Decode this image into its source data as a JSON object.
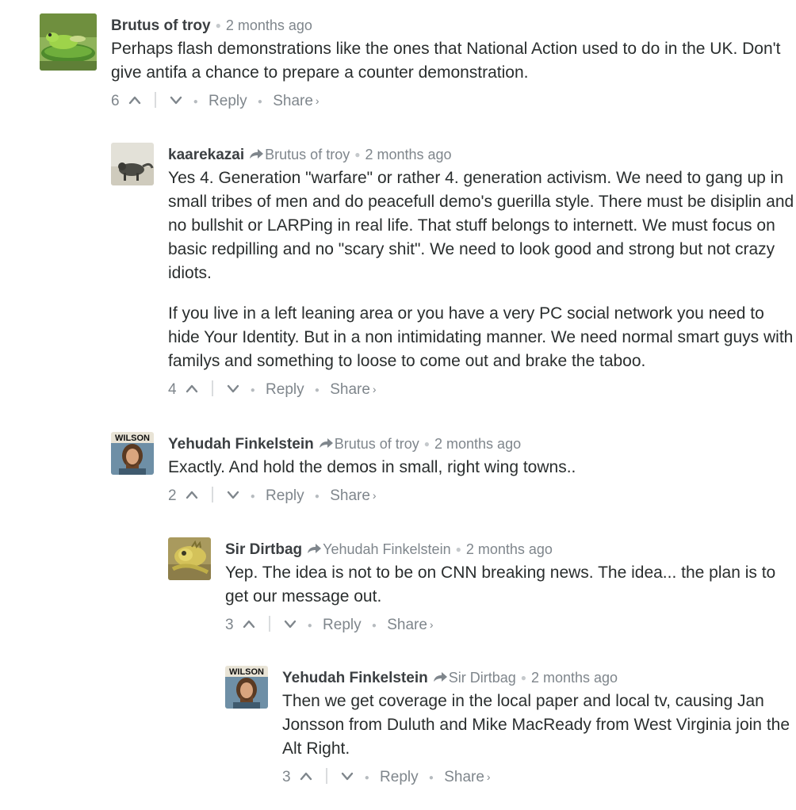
{
  "comments": [
    {
      "author": "Brutus of troy",
      "reply_to": "",
      "time": "2 months ago",
      "paragraphs": [
        "Perhaps flash demonstrations like the ones that National Action used to do in the UK. Don't give antifa a chance to prepare a counter demonstration."
      ],
      "votes": "6",
      "reply_label": "Reply",
      "share_label": "Share",
      "avatar_icon": "frog-on-lilypad-avatar"
    },
    {
      "author": "kaarekazai",
      "reply_to": "Brutus of troy",
      "time": "2 months ago",
      "paragraphs": [
        "Yes 4. Generation \"warfare\" or rather 4. generation activism. We need to gang up in small tribes of men and do peacefull demo's guerilla style. There must be disiplin and no bullshit or LARPing in real life. That stuff belongs to internett. We must focus on basic redpilling and no \"scary shit\". We need to look good and strong but not crazy idiots.",
        "If you live in a left leaning area or you have a very PC social network you need to hide Your Identity. But in a non intimidating manner. We need normal smart guys with familys and something to loose to come out and brake the taboo."
      ],
      "votes": "4",
      "reply_label": "Reply",
      "share_label": "Share",
      "avatar_icon": "animal-photo-avatar"
    },
    {
      "author": "Yehudah Finkelstein",
      "reply_to": "Brutus of troy",
      "time": "2 months ago",
      "paragraphs": [
        "Exactly. And hold the demos in small, right wing towns.."
      ],
      "votes": "2",
      "reply_label": "Reply",
      "share_label": "Share",
      "avatar_icon": "wilson-poster-avatar",
      "avatar_text": "WILSON"
    },
    {
      "author": "Sir Dirtbag",
      "reply_to": "Yehudah Finkelstein",
      "time": "2 months ago",
      "paragraphs": [
        "Yep. The idea is not to be on CNN breaking news. The idea... the plan is to get our message out."
      ],
      "votes": "3",
      "reply_label": "Reply",
      "share_label": "Share",
      "avatar_icon": "iguana-avatar"
    },
    {
      "author": "Yehudah Finkelstein",
      "reply_to": "Sir Dirtbag",
      "time": "2 months ago",
      "paragraphs": [
        "Then we get coverage in the local paper and local tv, causing Jan Jonsson from Duluth and Mike MacReady from West Virginia join the Alt Right."
      ],
      "votes": "3",
      "reply_label": "Reply",
      "share_label": "Share",
      "avatar_icon": "wilson-poster-avatar",
      "avatar_text": "WILSON"
    }
  ],
  "colors": {
    "text": "#2a2e2e",
    "author": "#3b3f42",
    "meta": "#7f868c",
    "separator": "#dadcde"
  }
}
